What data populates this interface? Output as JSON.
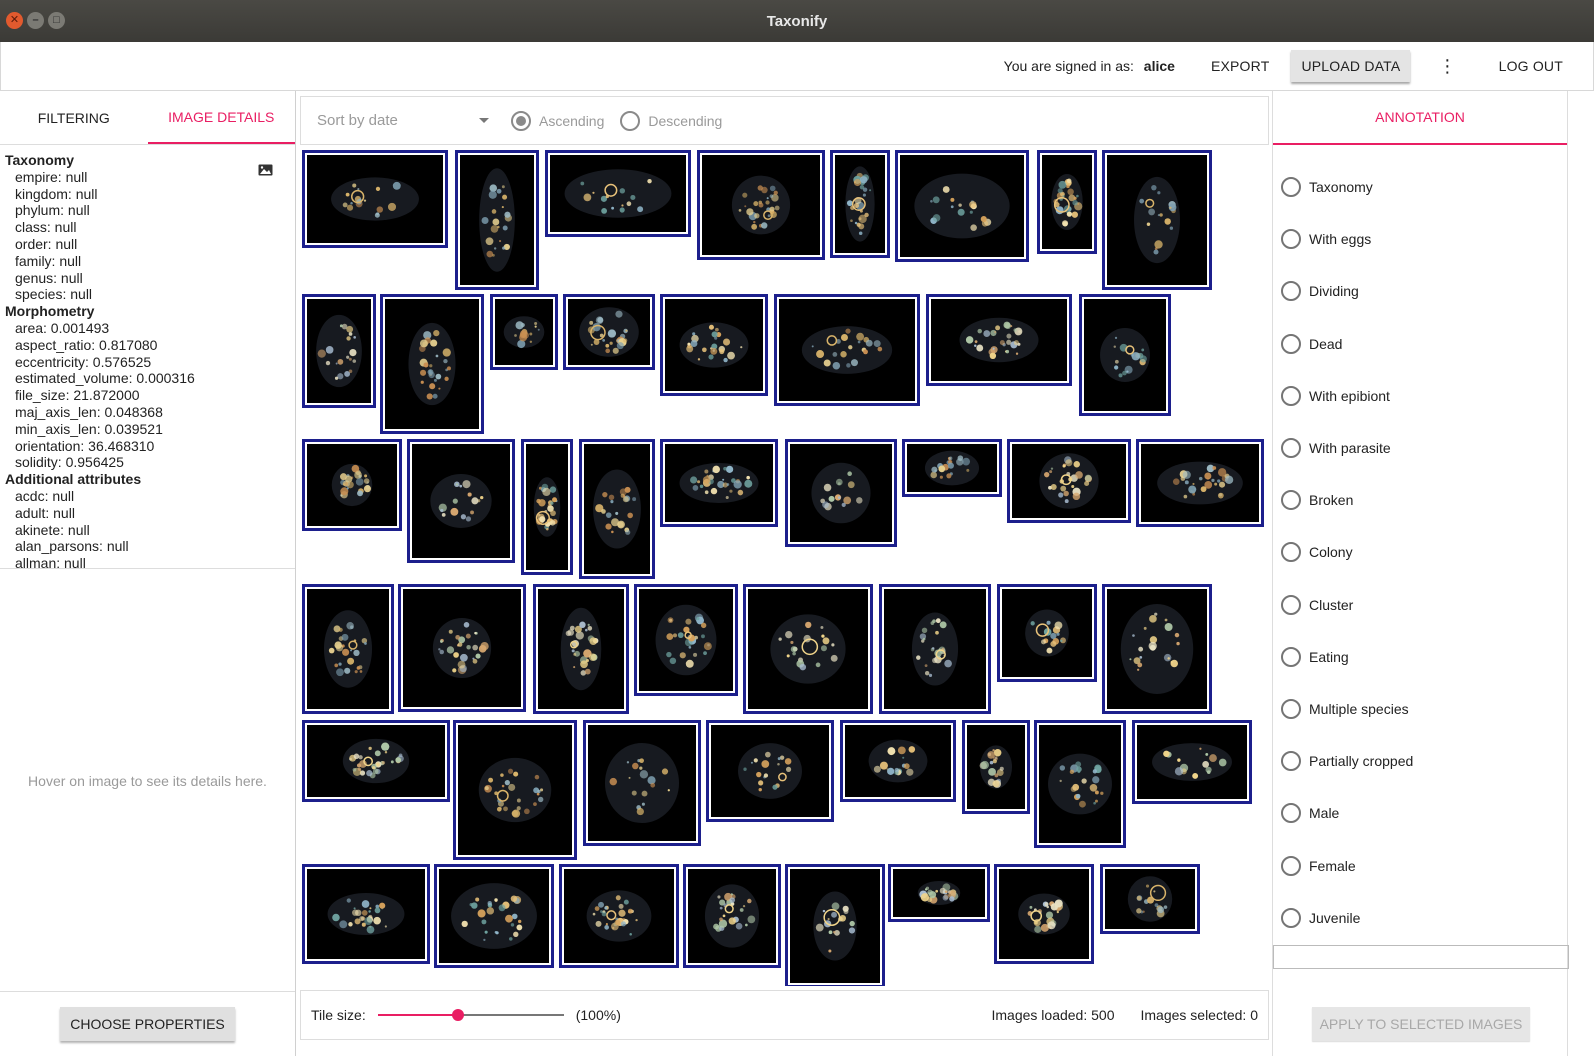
{
  "window": {
    "title": "Taxonify"
  },
  "appbar": {
    "signed_label": "You are signed in as:",
    "username": "alice",
    "export": "EXPORT",
    "upload": "UPLOAD DATA",
    "more": "⋮",
    "logout": "LOG OUT"
  },
  "left": {
    "tabs": [
      "FILTERING",
      "IMAGE DETAILS"
    ],
    "active_tab": "IMAGE DETAILS",
    "groups": [
      {
        "title": "Taxonomy",
        "items": [
          "empire: null",
          "kingdom: null",
          "phylum: null",
          "class: null",
          "order: null",
          "family: null",
          "genus: null",
          "species: null"
        ]
      },
      {
        "title": "Morphometry",
        "items": [
          "area: 0.001493",
          "aspect_ratio: 0.817080",
          "eccentricity: 0.576525",
          "estimated_volume: 0.000316",
          "file_size: 21.872000",
          "maj_axis_len: 0.048368",
          "min_axis_len: 0.039521",
          "orientation: 36.468310",
          "solidity: 0.956425"
        ]
      },
      {
        "title": "Additional attributes",
        "items": [
          "acdc: null",
          "adult: null",
          "akinete: null",
          "alan_parsons: null",
          "allman: null"
        ]
      }
    ],
    "hover_message": "Hover on image to see its details here.",
    "choose_properties": "CHOOSE PROPERTIES"
  },
  "sort": {
    "placeholder": "Sort by date",
    "ascending": "Ascending",
    "descending": "Descending",
    "selected": "Ascending"
  },
  "footer": {
    "tile_size_label": "Tile size:",
    "tile_size_value": "(100%)",
    "tile_size_fraction": 0.43,
    "images_loaded": "Images loaded: 500",
    "images_selected": "Images selected: 0"
  },
  "annotation": {
    "tab": "ANNOTATION",
    "options": [
      "Taxonomy",
      "With eggs",
      "Dividing",
      "Dead",
      "With epibiont",
      "With parasite",
      "Broken",
      "Colony",
      "Cluster",
      "Eating",
      "Multiple species",
      "Partially cropped",
      "Male",
      "Female",
      "Juvenile"
    ],
    "apply": "APPLY TO SELECTED IMAGES"
  },
  "colors": {
    "accent": "#e91e63",
    "tile_border": "#1c1f8c"
  }
}
